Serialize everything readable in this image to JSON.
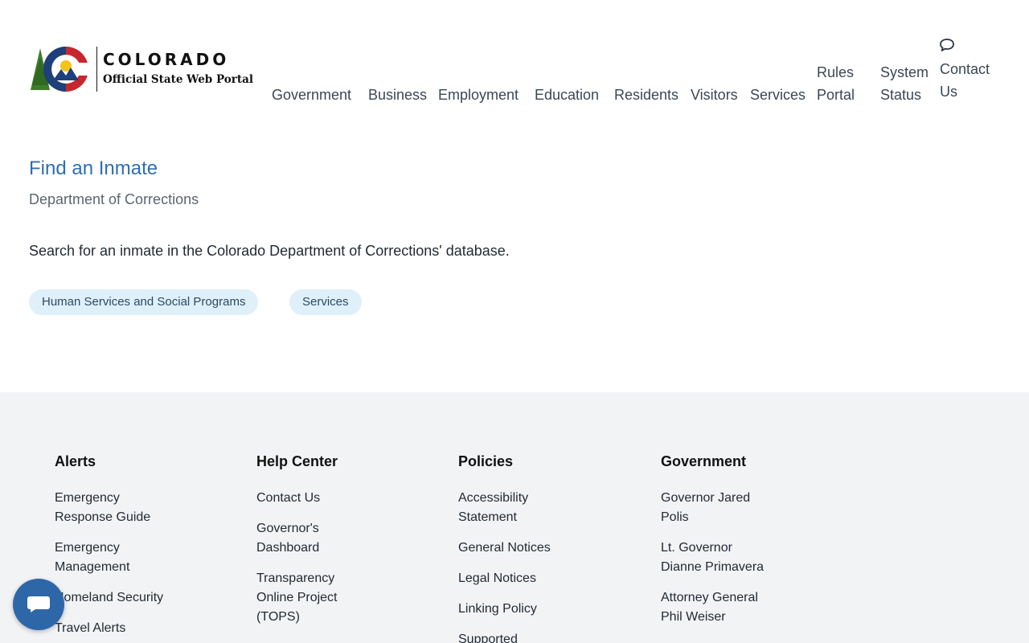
{
  "header": {
    "logo": {
      "title": "COLORADO",
      "subtitle": "Official State Web Portal",
      "icon": "colorado-c-logo-icon",
      "colors": {
        "blue": "#1d3f7a",
        "red": "#c8262e",
        "gold": "#f4c21a",
        "green": "#3f7d2c"
      }
    },
    "nav": {
      "government": "Government",
      "business": "Business",
      "employment": "Employment",
      "education": "Education",
      "residents": "Residents",
      "visitors": "Visitors",
      "services": "Services",
      "rules_portal": "Rules Portal",
      "system_status": "System Status",
      "contact_us": "Contact Us",
      "contact_icon": "speech-bubble-icon"
    }
  },
  "main": {
    "title": "Find an Inmate",
    "department": "Department of Corrections",
    "description": "Search for an inmate in the Colorado Department of Corrections' database.",
    "tags": [
      "Human Services and Social Programs",
      "Services"
    ]
  },
  "footer": {
    "columns": [
      {
        "heading": "Alerts",
        "links": [
          "Emergency Response Guide",
          "Emergency Management",
          "Homeland Security",
          "Travel Alerts"
        ]
      },
      {
        "heading": "Help Center",
        "links": [
          "Contact Us",
          "Governor's Dashboard",
          "Transparency Online Project (TOPS)"
        ]
      },
      {
        "heading": "Policies",
        "links": [
          "Accessibility Statement",
          "General Notices",
          "Legal Notices",
          "Linking Policy",
          "Supported"
        ]
      },
      {
        "heading": "Government",
        "links": [
          "Governor Jared Polis",
          "Lt. Governor Dianne Primavera",
          "Attorney General Phil Weiser"
        ]
      }
    ]
  },
  "chat": {
    "icon": "chat-bubble-icon",
    "color": "#2d67a8"
  },
  "colors": {
    "title": "#2f6faf",
    "tag_bg": "#dff0fa",
    "footer_bg": "#f2f3f5"
  }
}
